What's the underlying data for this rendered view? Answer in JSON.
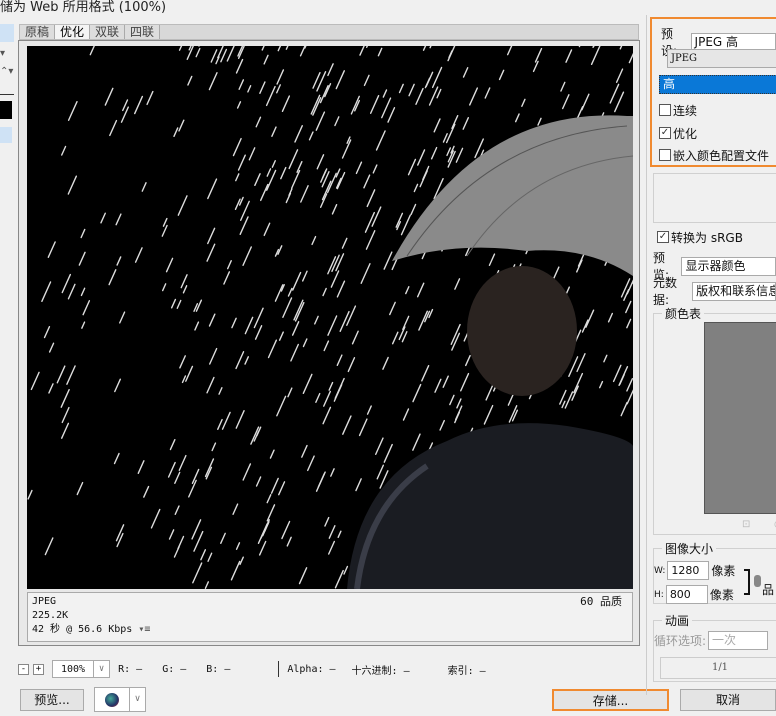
{
  "window": {
    "title": "储为 Web 所用格式 (100%)"
  },
  "tabs": [
    "原稿",
    "优化",
    "双联",
    "四联"
  ],
  "active_tab": 1,
  "info": {
    "format": "JPEG",
    "size": "225.2K",
    "time": "42 秒 @ 56.6 Kbps",
    "quality": "60 品质"
  },
  "status": {
    "zoom": "100%",
    "r": "R: —",
    "g": "G: —",
    "b": "B: —",
    "alpha": "Alpha: —",
    "hex": "十六进制: —",
    "index": "索引: —"
  },
  "buttons": {
    "preview": "预览...",
    "save": "存储...",
    "cancel": "取消"
  },
  "panel": {
    "preset_label": "预设:",
    "preset_value": "JPEG 高",
    "format": "JPEG",
    "quality_level": "高",
    "progressive": "连续",
    "progressive_checked": false,
    "optimized": "优化",
    "optimized_checked": true,
    "embed_profile": "嵌入颜色配置文件",
    "embed_checked": false,
    "convert_srgb": "转换为 sRGB",
    "convert_checked": true,
    "preview_label": "预览:",
    "preview_value": "显示器颜色",
    "metadata_label": "元数据:",
    "metadata_value": "版权和联系信息",
    "color_table": "颜色表",
    "image_size": "图像大小",
    "w_label": "W:",
    "w_value": "1280",
    "h_label": "H:",
    "h_value": "800",
    "unit": "像素",
    "quality_cut": "品",
    "animation": "动画",
    "loop_label": "循环选项:",
    "loop_value": "一次",
    "frame": "1/1"
  },
  "colors": {
    "accent": "#f08a30",
    "selection": "#0a78d7"
  }
}
